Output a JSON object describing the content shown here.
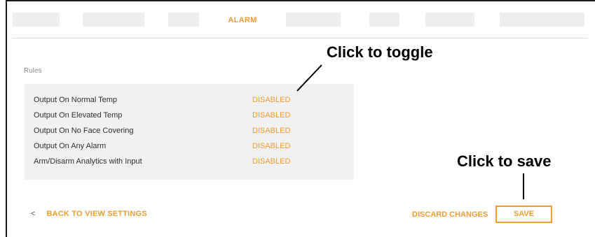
{
  "tabs": {
    "active_label": "ALARM"
  },
  "rules": {
    "section_label": "Rules",
    "items": [
      {
        "label": "Output On Normal Temp",
        "status": "DISABLED"
      },
      {
        "label": "Output On Elevated Temp",
        "status": "DISABLED"
      },
      {
        "label": "Output On No Face Covering",
        "status": "DISABLED"
      },
      {
        "label": "Output On Any Alarm",
        "status": "DISABLED"
      },
      {
        "label": "Arm/Disarm Analytics with Input",
        "status": "DISABLED"
      }
    ]
  },
  "footer": {
    "back_chevron": "<",
    "back_label": "BACK TO VIEW SETTINGS",
    "discard_label": "DISCARD CHANGES",
    "save_label": "SAVE"
  },
  "annotations": {
    "toggle_callout": "Click to toggle",
    "save_callout": "Click to save"
  },
  "colors": {
    "accent": "#f29b2f",
    "panel_bg": "#f1f1f1",
    "text": "#2f2f2f"
  }
}
